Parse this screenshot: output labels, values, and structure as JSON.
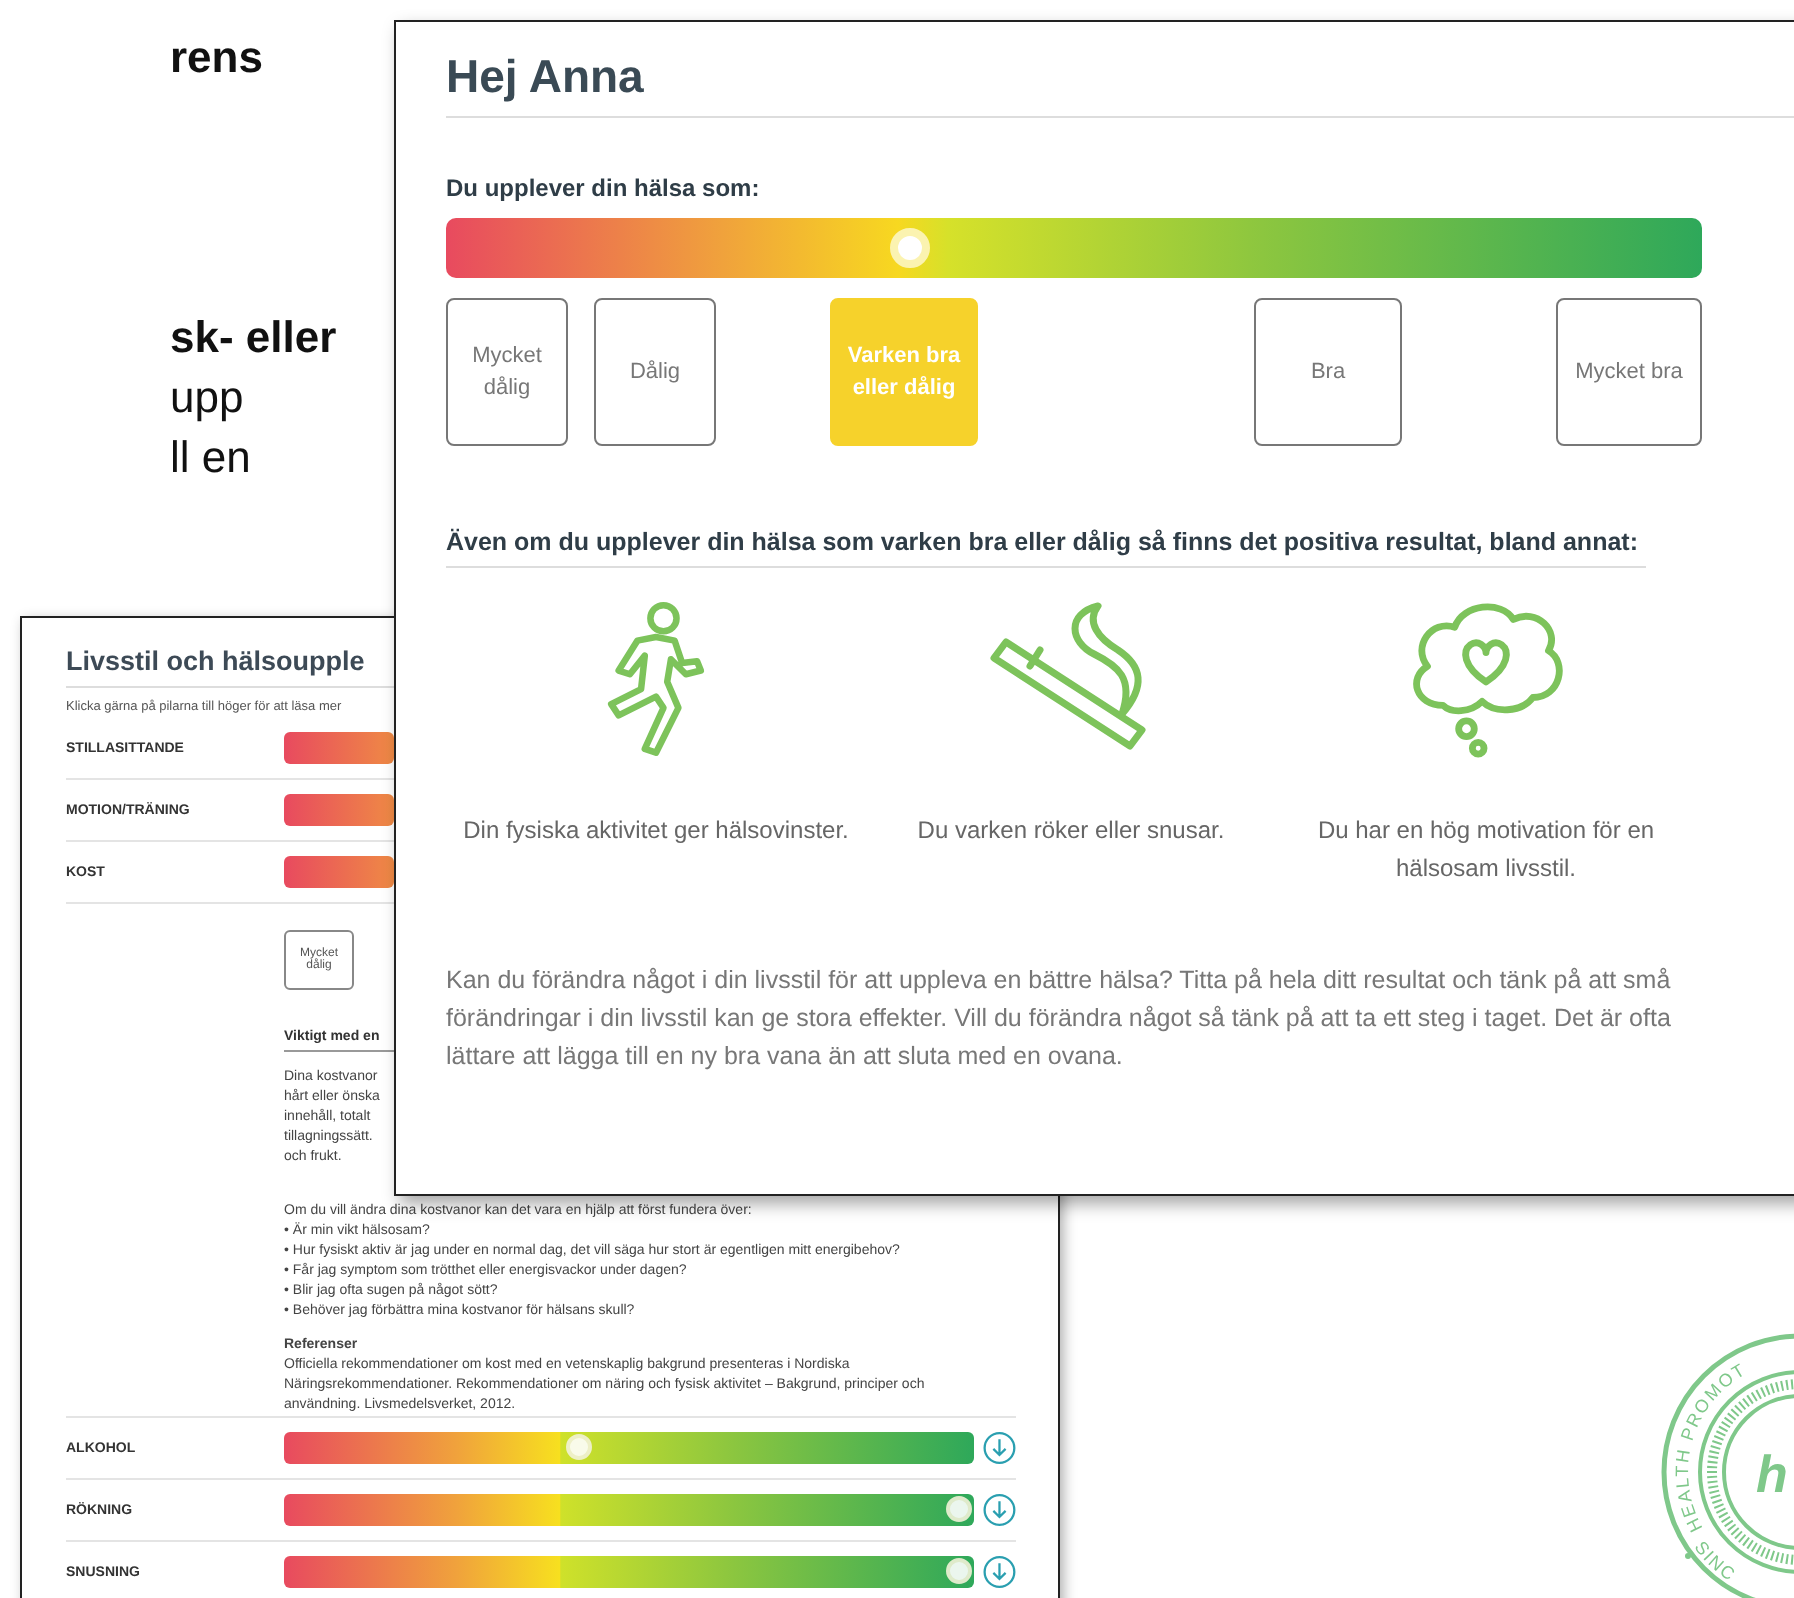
{
  "slide_text_fragments": [
    {
      "text": "rens",
      "bold": true,
      "gap_before": false
    },
    {
      "text": "sk- eller",
      "bold": true,
      "gap_before": true
    },
    {
      "text": "upp",
      "bold": false,
      "gap_before": false
    },
    {
      "text": "ll en",
      "bold": false,
      "gap_before": false
    }
  ],
  "back_window": {
    "title": "Livsstil och hälsoupple",
    "subtitle": "Klicka gärna på pilarna till höger för att läsa mer",
    "top_rows": [
      {
        "label": "STILLASITTANDE"
      },
      {
        "label": "MOTION/TRÄNING"
      },
      {
        "label": "KOST"
      }
    ],
    "kost_option": "Mycket dålig",
    "section_heading": "Viktigt med en",
    "fragment_lines": [
      "Dina kostvanor",
      "hårt eller önska",
      "innehåll, totalt",
      "tillagningssätt.",
      "och frukt."
    ],
    "intro": "Om du vill ändra dina kostvanor kan det vara en hjälp att först fundera över:",
    "bullets": [
      "• Är min vikt hälsosam?",
      "• Hur fysiskt aktiv är jag under en normal dag, det vill säga hur stort är egentligen mitt energibehov?",
      "• Får jag symptom som trötthet eller energisvackor under dagen?",
      "• Blir jag ofta sugen på något sött?",
      "• Behöver jag förbättra mina kostvanor för hälsans skull?"
    ],
    "references_heading": "Referenser",
    "references_text": "Officiella rekommendationer om kost med en vetenskaplig bakgrund presenteras i Nordiska Näringsrekommendationer. Rekommendationer om näring och fysisk aktivitet – Bakgrund, principer och användning. Livsmedelsverket, 2012.",
    "bottom_rows": [
      {
        "label": "ALKOHOL",
        "level": 0.43
      },
      {
        "label": "RÖKNING",
        "level": 0.98
      },
      {
        "label": "SNUSNING",
        "level": 0.98
      }
    ]
  },
  "front_window": {
    "title": "Hej Anna",
    "scale_label": "Du upplever din hälsa som:",
    "level": 0.37,
    "options": [
      {
        "label": "Mycket dålig",
        "selected": false
      },
      {
        "label": "Dålig",
        "selected": false
      },
      {
        "label": "Varken bra eller dålig",
        "selected": true
      },
      {
        "label": "Bra",
        "selected": false
      },
      {
        "label": "Mycket bra",
        "selected": false
      }
    ],
    "results_heading": "Även om du upplever din hälsa som varken bra eller dålig så finns det positiva resultat, bland annat:",
    "results": [
      {
        "kind": "runner",
        "text": "Din fysiska aktivitet ger hälsovinster."
      },
      {
        "kind": "cigarette",
        "text": "Du varken röker eller snusar."
      },
      {
        "kind": "thought",
        "text": "Du har en hög motivation för en hälsosam livsstil."
      }
    ],
    "advice": "Kan du förändra något i din livsstil för att uppleva en bättre hälsa? Titta på hela ditt resultat och tänk på att små förändringar i din livsstil kan ge stora effekter. Vill du förändra något så tänk på att ta ett steg i taget. Det är ofta lättare att lägga till en ny bra vana än att sluta med en ovana."
  },
  "logo": {
    "ring_text": "HEALTH PROMOT",
    "bottom_text": "SINC",
    "letter": "h"
  }
}
